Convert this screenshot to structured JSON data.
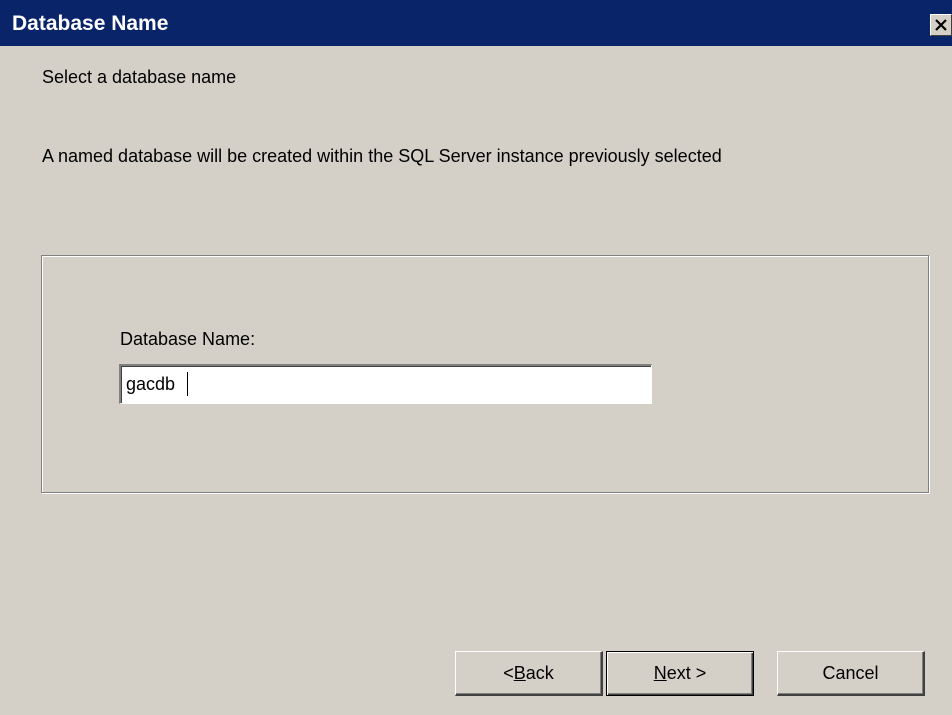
{
  "window": {
    "title": "Database Name",
    "close_glyph": "✕"
  },
  "page": {
    "heading": "Select a database name",
    "description": "A named database will be created within the SQL Server instance previously selected"
  },
  "form": {
    "database_name_label": "Database Name:",
    "database_name_value": "gacdb"
  },
  "buttons": {
    "back": {
      "prefix": "< ",
      "mnemonic": "B",
      "rest": "ack"
    },
    "next": {
      "prefix": "",
      "mnemonic": "N",
      "rest": "ext >"
    },
    "cancel": "Cancel"
  },
  "colors": {
    "titlebar": "#0a246a",
    "dialog_bg": "#d4d0c8"
  }
}
